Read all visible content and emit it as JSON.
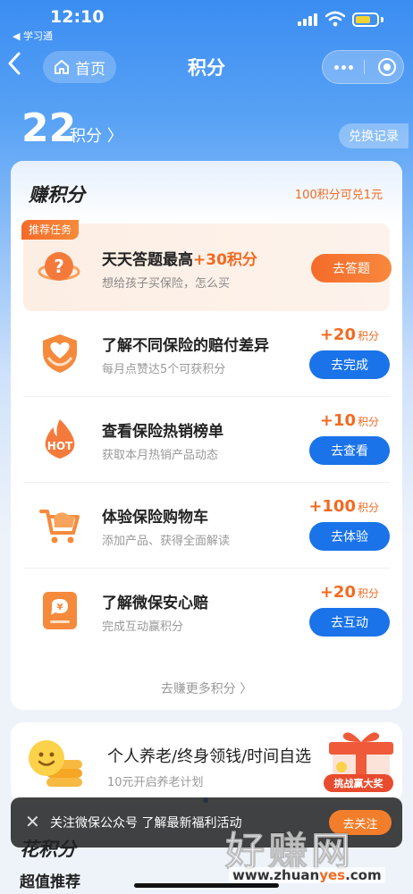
{
  "status_bar": {
    "time": "12:10",
    "back_app": "◀ 学习通"
  },
  "nav": {
    "home_label": "首页",
    "title": "积分"
  },
  "points": {
    "value": "22",
    "unit": "积分",
    "exchange_label": "兑换记录"
  },
  "earn": {
    "title": "赚积分",
    "rate": "100积分可兑1元",
    "featured": {
      "tag": "推荐任务",
      "title": "天天答题最高",
      "bonus": "+30积分",
      "desc": "想给孩子买保险，怎么买",
      "button": "去答题"
    },
    "tasks": [
      {
        "title": "了解不同保险的赔付差异",
        "desc": "每月点赞达5个可获积分",
        "reward": "+20",
        "unit": "积分",
        "button": "去完成",
        "icon": "shield-heart-icon"
      },
      {
        "title": "查看保险热销榜单",
        "desc": "获取本月热销产品动态",
        "reward": "+10",
        "unit": "积分",
        "button": "去查看",
        "icon": "hot-flame-icon"
      },
      {
        "title": "体验保险购物车",
        "desc": "添加产品、获得全面解读",
        "reward": "+100",
        "unit": "积分",
        "button": "去体验",
        "icon": "shopping-cart-icon"
      },
      {
        "title": "了解微保安心赔",
        "desc": "完成互动赢积分",
        "reward": "+20",
        "unit": "积分",
        "button": "去互动",
        "icon": "yen-chat-icon"
      }
    ],
    "more": "去赚更多积分 〉"
  },
  "pension": {
    "title": "个人养老/终身领钱/时间自选",
    "sub": "10元开启养老计划",
    "gift_label": "挑战赢大奖"
  },
  "toast": {
    "text": "关注微保公众号 了解最新福利活动",
    "button": "去关注"
  },
  "spend_title": "花积分",
  "recommend_title": "超值推荐",
  "watermark": {
    "main": "好赚网",
    "url_a": "www.zhuan",
    "url_b": "yes",
    "url_c": ".com"
  },
  "colors": {
    "brand_blue": "#1a73e8",
    "accent_orange": "#f26a21"
  }
}
